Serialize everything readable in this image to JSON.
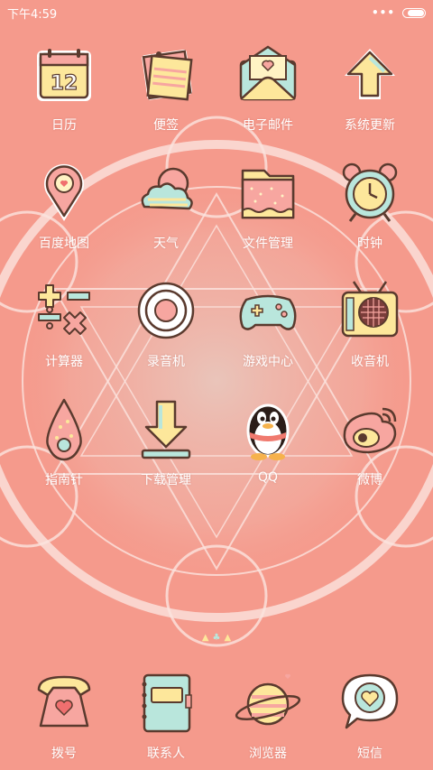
{
  "status_bar": {
    "time": "下午4:59",
    "menu_dots": "•••",
    "battery_level": 0.85
  },
  "apps": [
    {
      "label": "日历",
      "icon": "calendar-icon"
    },
    {
      "label": "便签",
      "icon": "notes-icon"
    },
    {
      "label": "电子邮件",
      "icon": "mail-icon"
    },
    {
      "label": "系统更新",
      "icon": "update-arrow-icon"
    },
    {
      "label": "百度地图",
      "icon": "map-pin-icon"
    },
    {
      "label": "天气",
      "icon": "weather-icon"
    },
    {
      "label": "文件管理",
      "icon": "folder-icon"
    },
    {
      "label": "时钟",
      "icon": "alarm-clock-icon"
    },
    {
      "label": "计算器",
      "icon": "calculator-icon"
    },
    {
      "label": "录音机",
      "icon": "recorder-icon"
    },
    {
      "label": "游戏中心",
      "icon": "gamepad-icon"
    },
    {
      "label": "收音机",
      "icon": "radio-icon"
    },
    {
      "label": "指南针",
      "icon": "compass-icon"
    },
    {
      "label": "下载管理",
      "icon": "download-icon"
    },
    {
      "label": "QQ",
      "icon": "qq-penguin-icon"
    },
    {
      "label": "微博",
      "icon": "weibo-icon"
    }
  ],
  "dock": [
    {
      "label": "拨号",
      "icon": "telephone-icon"
    },
    {
      "label": "联系人",
      "icon": "contacts-book-icon"
    },
    {
      "label": "浏览器",
      "icon": "planet-icon"
    },
    {
      "label": "短信",
      "icon": "message-bubble-icon"
    }
  ],
  "colors": {
    "background": "#f59a8c",
    "outline": "#5a3a2e",
    "cream": "#fff3c4",
    "pink": "#f7a6a0",
    "mint": "#b9e6dc",
    "yellow": "#fde79b"
  }
}
